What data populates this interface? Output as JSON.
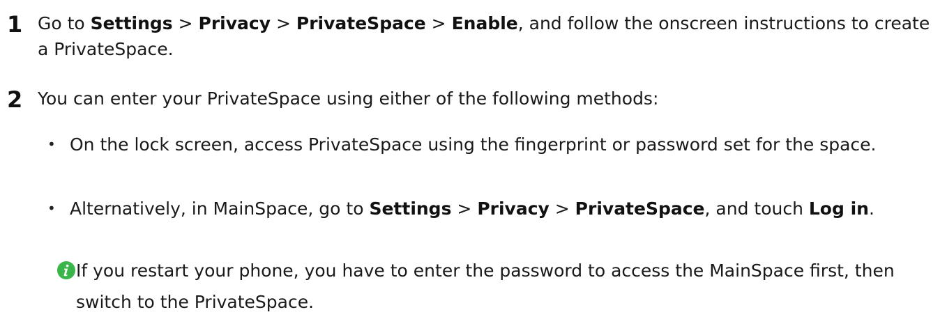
{
  "steps": [
    {
      "number": "1",
      "parts": {
        "p0": "Go to ",
        "b0": "Settings",
        "p1": " > ",
        "b1": "Privacy",
        "p2": " > ",
        "b2": "PrivateSpace",
        "p3": " > ",
        "b3": "Enable",
        "p4": ", and follow the onscreen instructions to create a PrivateSpace."
      }
    },
    {
      "number": "2",
      "text": "You can enter your PrivateSpace using either of the following methods:"
    }
  ],
  "bullets": [
    {
      "marker": "•",
      "text": "On the lock screen, access PrivateSpace using the fingerprint or password set for the space."
    },
    {
      "marker": "•",
      "parts": {
        "p0": "Alternatively, in MainSpace, go to ",
        "b0": "Settings",
        "p1": " > ",
        "b1": "Privacy",
        "p2": " > ",
        "b2": "PrivateSpace",
        "p3": ", and touch ",
        "b3": "Log in",
        "p4": "."
      }
    }
  ],
  "note": {
    "icon": "info-icon",
    "icon_color": "#39b54a",
    "text": "If you restart your phone, you have to enter the password to access the MainSpace first, then switch to the PrivateSpace."
  }
}
